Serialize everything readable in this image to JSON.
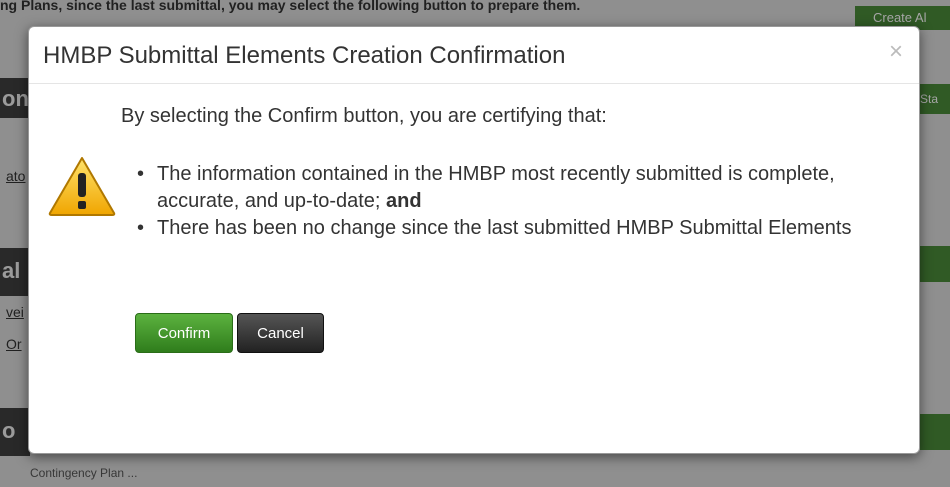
{
  "background": {
    "top_text": "ng Plans, since the last submittal, you may select the following button to prepare them.",
    "create_all_button": "Create Al",
    "bar_letters": [
      "on",
      "al",
      "o"
    ],
    "left_links": [
      "ato",
      "vei",
      "Or"
    ],
    "right_label": "Sta",
    "bottom_text": "Contingency Plan ..."
  },
  "dialog": {
    "title": "HMBP Submittal Elements Creation Confirmation",
    "close_symbol": "×",
    "intro": "By selecting the Confirm button, you are certifying that:",
    "bullet1": "The information contained in the HMBP most recently submitted is complete, accurate, and up-to-date;",
    "bullet1_emphasis": "and",
    "bullet2": "There has been no change since the last submitted HMBP Submittal Elements",
    "confirm_label": "Confirm",
    "cancel_label": "Cancel",
    "icon": "warning-icon",
    "colors": {
      "confirm": "#3d9a2a",
      "cancel": "#333333",
      "warning": "#f5c518"
    }
  }
}
